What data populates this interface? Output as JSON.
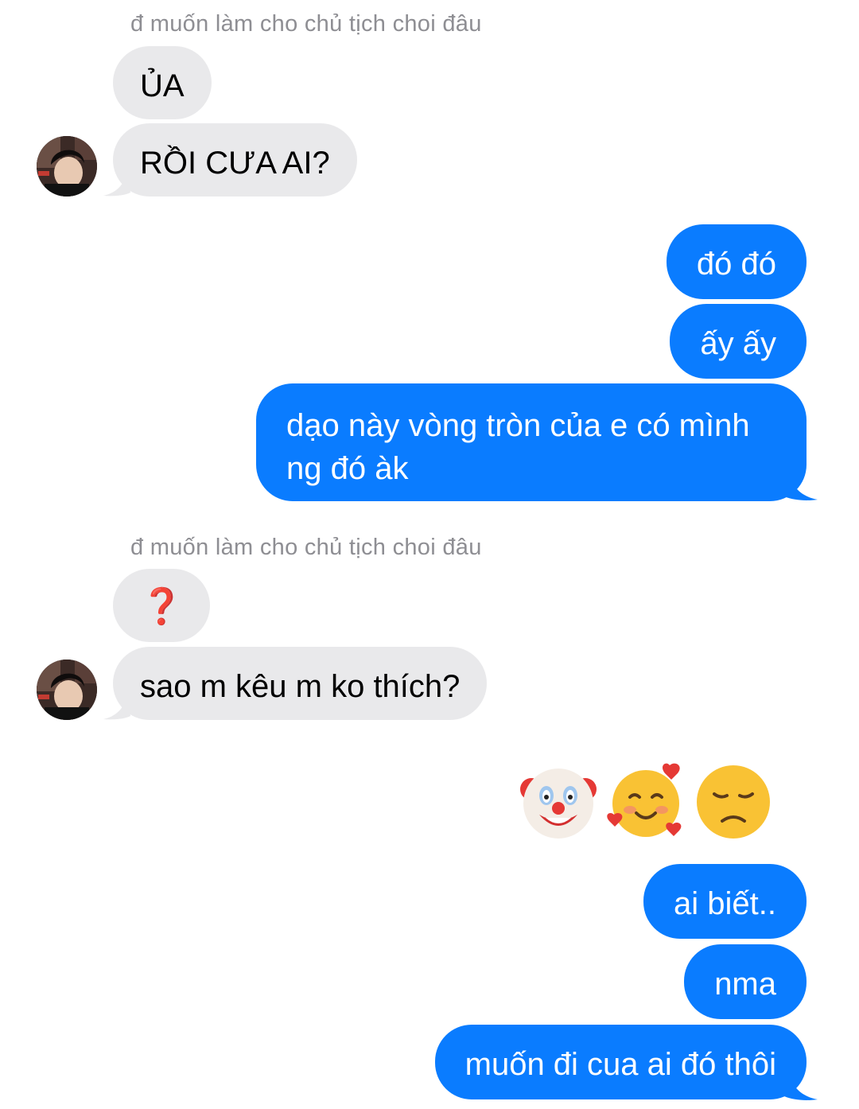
{
  "thread": {
    "group1": {
      "sender_name": "đ muốn làm cho chủ tịch choi đâu",
      "msg1": "ỦA",
      "msg2": "RỒI CƯA AI?"
    },
    "group2": {
      "msg1": "đó đó",
      "msg2": "ấy ấy",
      "msg3": "dạo này vòng tròn của e có mình ng đó àk"
    },
    "group3": {
      "sender_name": "đ muốn làm cho chủ tịch choi đâu",
      "msg1": "❓",
      "msg2": "sao m kêu m ko thích?"
    },
    "group4": {
      "emojis": [
        "clown-face-emoji",
        "smiling-face-with-hearts-emoji",
        "disappointed-face-emoji"
      ],
      "msg1": "ai biết..",
      "msg2": "nma",
      "msg3": "muốn đi cua ai đó thôi"
    }
  },
  "colors": {
    "incoming_bubble": "#e9e9eb",
    "outgoing_bubble": "#0a7cff",
    "sender_name": "#8e8e93",
    "question_mark": "#d7141f"
  }
}
